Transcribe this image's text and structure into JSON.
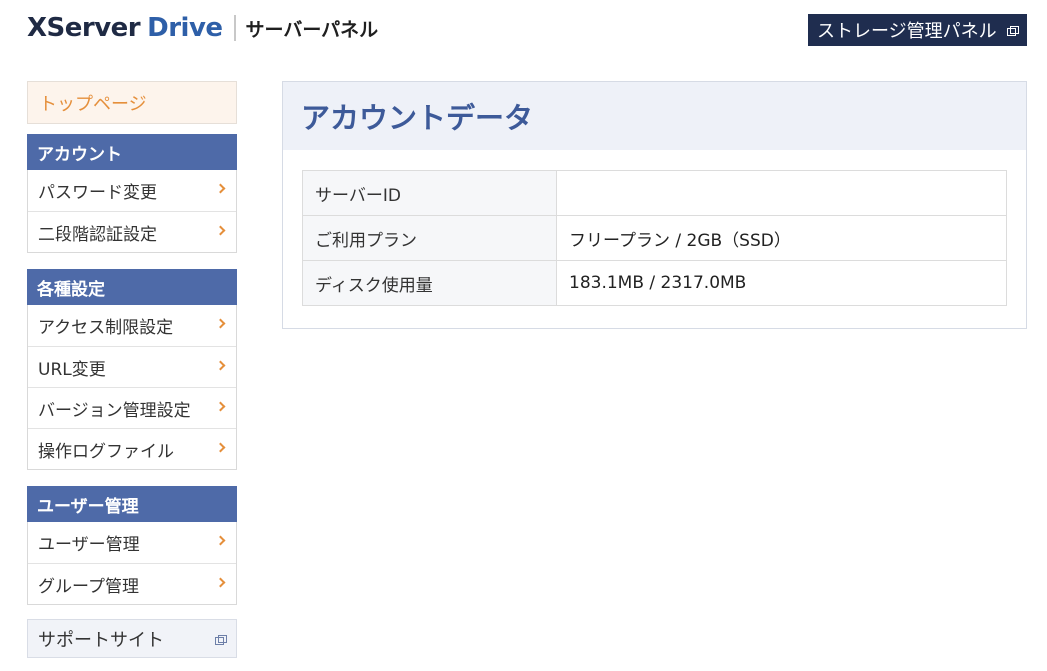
{
  "header": {
    "logo_x": "X",
    "logo_server": "Server",
    "logo_drive": "Drive",
    "panel_title": "サーバーパネル",
    "storage_button": "ストレージ管理パネル"
  },
  "sidebar": {
    "top_page": "トップページ",
    "groups": [
      {
        "title": "アカウント",
        "items": [
          "パスワード変更",
          "二段階認証設定"
        ]
      },
      {
        "title": "各種設定",
        "items": [
          "アクセス制限設定",
          "URL変更",
          "バージョン管理設定",
          "操作ログファイル"
        ]
      },
      {
        "title": "ユーザー管理",
        "items": [
          "ユーザー管理",
          "グループ管理"
        ]
      }
    ],
    "support": "サポートサイト"
  },
  "main": {
    "title": "アカウントデータ",
    "rows": [
      {
        "label": "サーバーID",
        "value": ""
      },
      {
        "label": "ご利用プラン",
        "value": "フリープラン / 2GB（SSD）"
      },
      {
        "label": "ディスク使用量",
        "value": "183.1MB / 2317.0MB"
      }
    ]
  },
  "colors": {
    "accent_orange": "#e58f3b",
    "nav_blue": "#4e6aa8",
    "header_dark": "#1f2d4f",
    "title_blue": "#3d5a99"
  }
}
